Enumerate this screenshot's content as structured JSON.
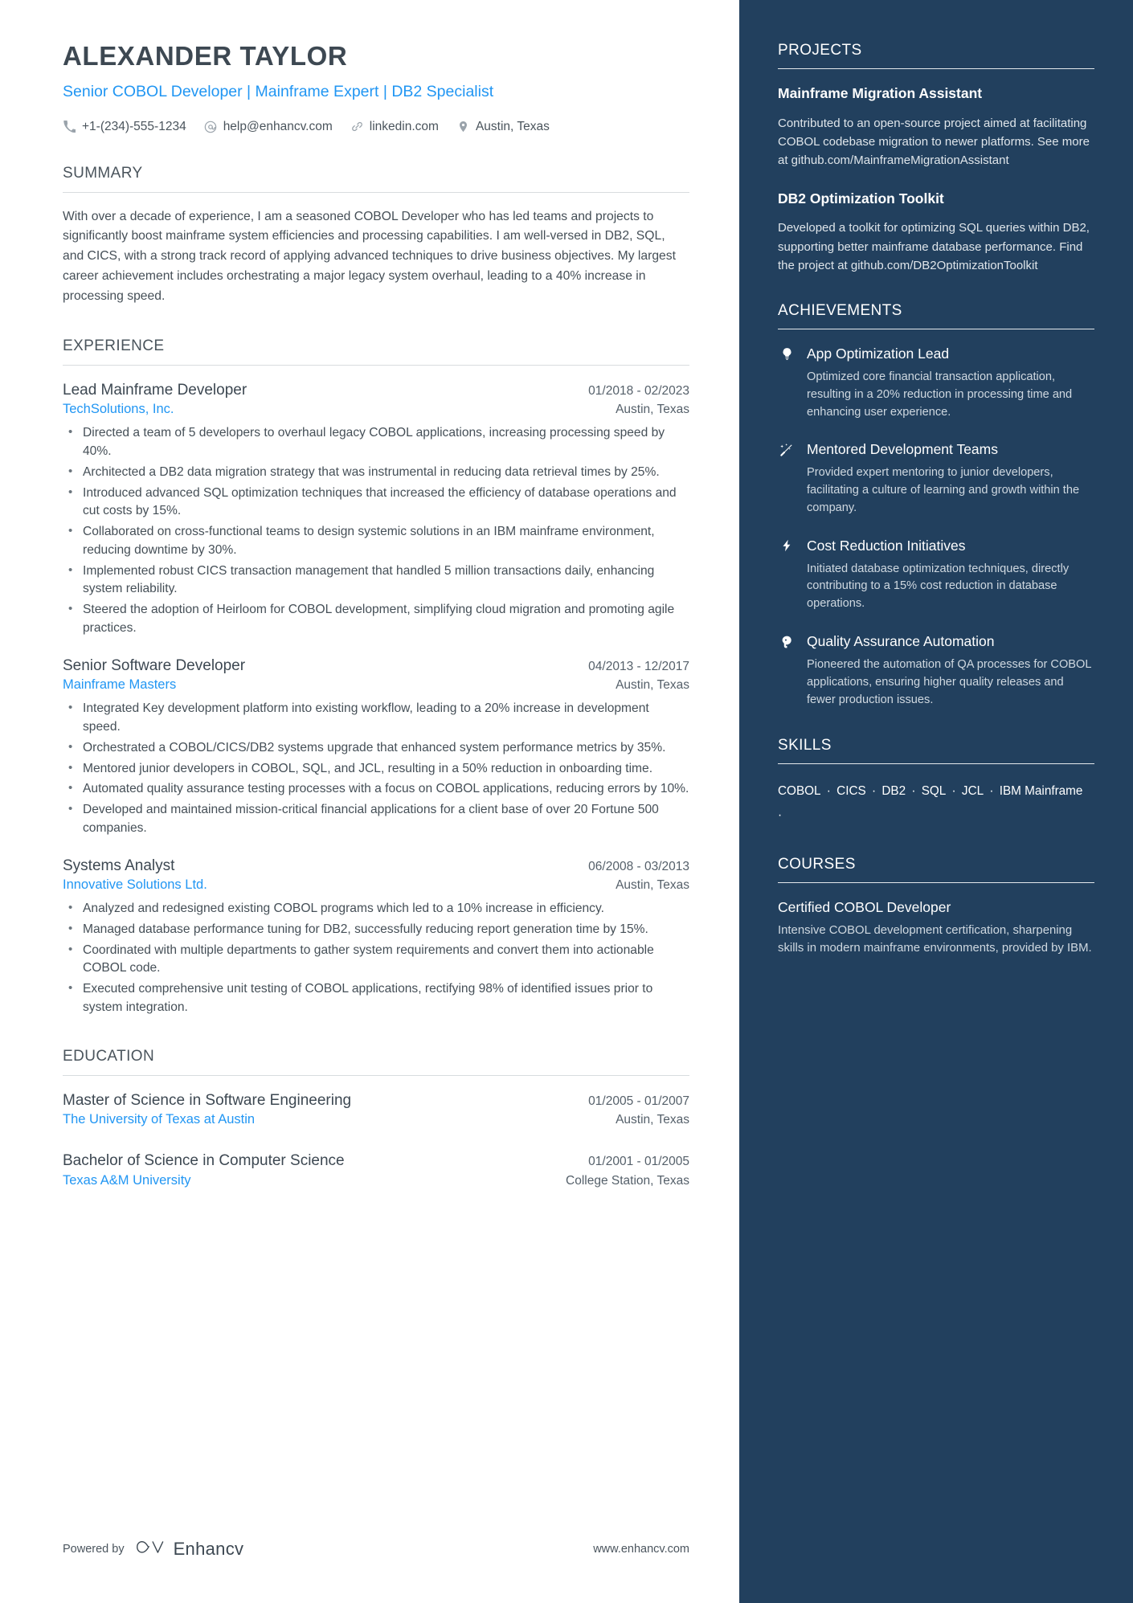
{
  "header": {
    "name": "ALEXANDER TAYLOR",
    "headline": "Senior COBOL Developer | Mainframe Expert | DB2 Specialist",
    "contacts": [
      {
        "icon": "phone-icon",
        "text": "+1-(234)-555-1234"
      },
      {
        "icon": "email-icon",
        "text": "help@enhancv.com"
      },
      {
        "icon": "link-icon",
        "text": "linkedin.com"
      },
      {
        "icon": "location-pin-icon",
        "text": "Austin, Texas"
      }
    ]
  },
  "summary": {
    "title": "SUMMARY",
    "text": "With over a decade of experience, I am a seasoned COBOL Developer who has led teams and projects to significantly boost mainframe system efficiencies and processing capabilities. I am well-versed in DB2, SQL, and CICS, with a strong track record of applying advanced techniques to drive business objectives. My largest career achievement includes orchestrating a major legacy system overhaul, leading to a 40% increase in processing speed."
  },
  "experience": {
    "title": "EXPERIENCE",
    "entries": [
      {
        "role": "Lead Mainframe Developer",
        "dates": "01/2018 - 02/2023",
        "company": "TechSolutions, Inc.",
        "location": "Austin, Texas",
        "bullets": [
          "Directed a team of 5 developers to overhaul legacy COBOL applications, increasing processing speed by 40%.",
          "Architected a DB2 data migration strategy that was instrumental in reducing data retrieval times by 25%.",
          "Introduced advanced SQL optimization techniques that increased the efficiency of database operations and cut costs by 15%.",
          "Collaborated on cross-functional teams to design systemic solutions in an IBM mainframe environment, reducing downtime by 30%.",
          "Implemented robust CICS transaction management that handled 5 million transactions daily, enhancing system reliability.",
          "Steered the adoption of Heirloom for COBOL development, simplifying cloud migration and promoting agile practices."
        ]
      },
      {
        "role": "Senior Software Developer",
        "dates": "04/2013 - 12/2017",
        "company": "Mainframe Masters",
        "location": "Austin, Texas",
        "bullets": [
          "Integrated Key development platform into existing workflow, leading to a 20% increase in development speed.",
          "Orchestrated a COBOL/CICS/DB2 systems upgrade that enhanced system performance metrics by 35%.",
          "Mentored junior developers in COBOL, SQL, and JCL, resulting in a 50% reduction in onboarding time.",
          "Automated quality assurance testing processes with a focus on COBOL applications, reducing errors by 10%.",
          "Developed and maintained mission-critical financial applications for a client base of over 20 Fortune 500 companies."
        ]
      },
      {
        "role": "Systems Analyst",
        "dates": "06/2008 - 03/2013",
        "company": "Innovative Solutions Ltd.",
        "location": "Austin, Texas",
        "bullets": [
          "Analyzed and redesigned existing COBOL programs which led to a 10% increase in efficiency.",
          "Managed database performance tuning for DB2, successfully reducing report generation time by 15%.",
          "Coordinated with multiple departments to gather system requirements and convert them into actionable COBOL code.",
          "Executed comprehensive unit testing of COBOL applications, rectifying 98% of identified issues prior to system integration."
        ]
      }
    ]
  },
  "education": {
    "title": "EDUCATION",
    "entries": [
      {
        "degree": "Master of Science in Software Engineering",
        "dates": "01/2005 - 01/2007",
        "school": "The University of Texas at Austin",
        "location": "Austin, Texas"
      },
      {
        "degree": "Bachelor of Science in Computer Science",
        "dates": "01/2001 - 01/2005",
        "school": "Texas A&M University",
        "location": "College Station, Texas"
      }
    ]
  },
  "projects": {
    "title": "PROJECTS",
    "entries": [
      {
        "name": "Mainframe Migration Assistant",
        "description": "Contributed to an open-source project aimed at facilitating COBOL codebase migration to newer platforms. See more at github.com/MainframeMigrationAssistant"
      },
      {
        "name": "DB2 Optimization Toolkit",
        "description": "Developed a toolkit for optimizing SQL queries within DB2, supporting better mainframe database performance. Find the project at github.com/DB2OptimizationToolkit"
      }
    ]
  },
  "achievements": {
    "title": "ACHIEVEMENTS",
    "entries": [
      {
        "icon": "lightbulb-icon",
        "title": "App Optimization Lead",
        "description": "Optimized core financial transaction application, resulting in a 20% reduction in processing time and enhancing user experience."
      },
      {
        "icon": "magic-wand-icon",
        "title": "Mentored Development Teams",
        "description": "Provided expert mentoring to junior developers, facilitating a culture of learning and growth within the company."
      },
      {
        "icon": "lightning-bolt-icon",
        "title": "Cost Reduction Initiatives",
        "description": "Initiated database optimization techniques, directly contributing to a 15% cost reduction in database operations."
      },
      {
        "icon": "head-profile-icon",
        "title": "Quality Assurance Automation",
        "description": "Pioneered the automation of QA processes for COBOL applications, ensuring higher quality releases and fewer production issues."
      }
    ]
  },
  "skills": {
    "title": "SKILLS",
    "items": [
      "COBOL",
      "CICS",
      "DB2",
      "SQL",
      "JCL",
      "IBM Mainframe"
    ],
    "separator": "·"
  },
  "courses": {
    "title": "COURSES",
    "entries": [
      {
        "name": "Certified COBOL Developer",
        "description": "Intensive COBOL development certification, sharpening skills in modern mainframe environments, provided by IBM."
      }
    ]
  },
  "footer": {
    "powered_by": "Powered by",
    "brand": "Enhancv",
    "website": "www.enhancv.com"
  },
  "colors": {
    "accent_blue": "#2196f3",
    "sidebar_bg": "#22405e",
    "text_dark": "#3d4852"
  }
}
